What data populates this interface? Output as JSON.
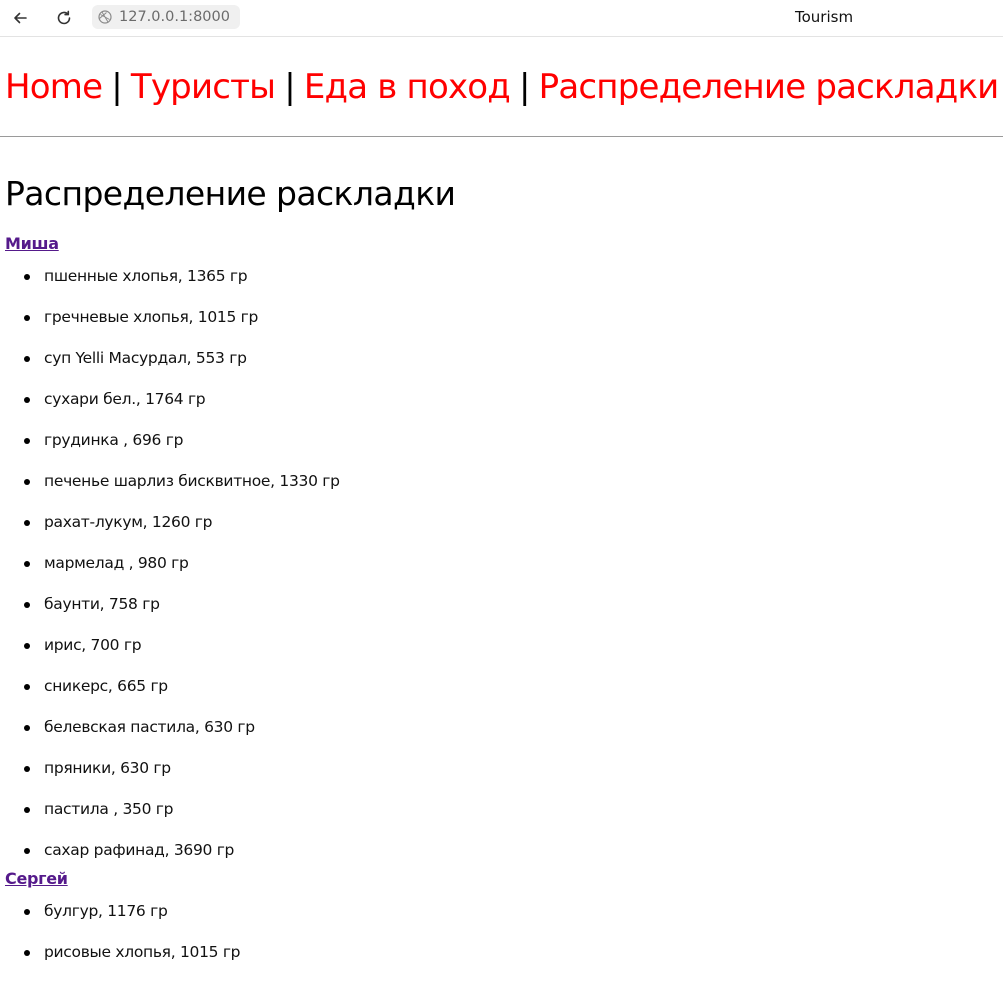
{
  "browser": {
    "url": "127.0.0.1:8000",
    "window_title": "Tourism",
    "back_icon": "arrow-left-icon",
    "reload_icon": "reload-icon",
    "site_icon": "globe-icon"
  },
  "menu": {
    "items": [
      "Home",
      "Туристы",
      "Еда в поход",
      "Распределение раскладки"
    ],
    "separator": "|"
  },
  "page_title": "Распределение раскладки",
  "people": [
    {
      "name": "Миша",
      "items": [
        "пшенные хлопья, 1365 гр",
        "гречневые хлопья, 1015 гр",
        "суп Yelli Масурдал, 553 гр",
        "сухари бел., 1764 гр",
        "грудинка , 696 гр",
        "печенье шарлиз бисквитное, 1330 гр",
        "рахат-лукум, 1260 гр",
        "мармелад , 980 гр",
        "баунти, 758 гр",
        "ирис, 700 гр",
        "сникерс, 665 гр",
        "белевская пастила, 630 гр",
        "пряники, 630 гр",
        "пастила , 350 гр",
        "сахар рафинад, 3690 гр"
      ]
    },
    {
      "name": "Сергей",
      "items": [
        "булгур, 1176 гр",
        "рисовые хлопья, 1015 гр"
      ]
    }
  ],
  "colors": {
    "menu_link": "#ff0000",
    "visited_link": "#551a8b"
  }
}
